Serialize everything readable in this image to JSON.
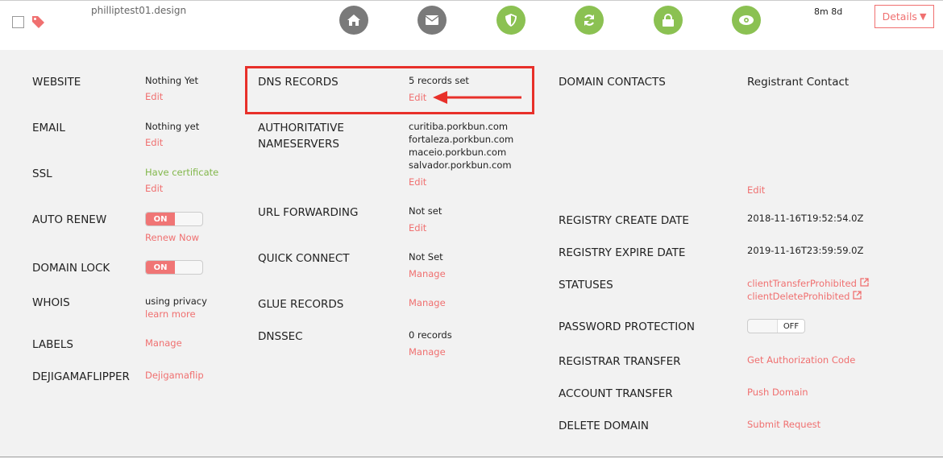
{
  "header": {
    "domain": "philliptest01.design",
    "time_left": "8m 8d",
    "details_label": "Details",
    "details_arrow": "▼",
    "icons": [
      "home-icon",
      "mail-icon",
      "shield-icon",
      "refresh-icon",
      "lock-icon",
      "eye-icon"
    ]
  },
  "col1": {
    "website": {
      "label": "WEBSITE",
      "value": "Nothing Yet",
      "link": "Edit"
    },
    "email": {
      "label": "EMAIL",
      "value": "Nothing yet",
      "link": "Edit"
    },
    "ssl": {
      "label": "SSL",
      "value": "Have certificate",
      "link": "Edit"
    },
    "auto_renew": {
      "label": "AUTO RENEW",
      "toggle": "ON",
      "link": "Renew Now"
    },
    "domain_lock": {
      "label": "DOMAIN LOCK",
      "toggle": "ON"
    },
    "whois": {
      "label": "WHOIS",
      "value": "using privacy",
      "link": "learn more"
    },
    "labels": {
      "label": "LABELS",
      "link": "Manage"
    },
    "dejigamaflipper": {
      "label": "DEJIGAMAFLIPPER",
      "link": "Dejigamaflip"
    }
  },
  "col2": {
    "dns": {
      "label": "DNS RECORDS",
      "value": "5 records set",
      "link": "Edit"
    },
    "ns": {
      "label1": "AUTHORITATIVE",
      "label2": "NAMESERVERS",
      "servers": [
        "curitiba.porkbun.com",
        "fortaleza.porkbun.com",
        "maceio.porkbun.com",
        "salvador.porkbun.com"
      ],
      "link": "Edit"
    },
    "url": {
      "label": "URL FORWARDING",
      "value": "Not set",
      "link": "Edit"
    },
    "quick": {
      "label": "QUICK CONNECT",
      "value": "Not Set",
      "link": "Manage"
    },
    "glue": {
      "label": "GLUE RECORDS",
      "link": "Manage"
    },
    "dnssec": {
      "label": "DNSSEC",
      "value": "0 records",
      "link": "Manage"
    }
  },
  "col3": {
    "contacts": {
      "label": "DOMAIN CONTACTS",
      "value": "Registrant Contact",
      "link": "Edit"
    },
    "create": {
      "label": "REGISTRY CREATE DATE",
      "value": "2018-11-16T19:52:54.0Z"
    },
    "expire": {
      "label": "REGISTRY EXPIRE DATE",
      "value": "2019-11-16T23:59:59.0Z"
    },
    "statuses": {
      "label": "STATUSES",
      "items": [
        "clientTransferProhibited",
        "clientDeleteProhibited"
      ]
    },
    "password": {
      "label": "PASSWORD PROTECTION",
      "toggle": "OFF"
    },
    "registrar": {
      "label": "REGISTRAR TRANSFER",
      "link": "Get Authorization Code"
    },
    "account": {
      "label": "ACCOUNT TRANSFER",
      "link": "Push Domain"
    },
    "delete": {
      "label": "DELETE DOMAIN",
      "link": "Submit Request"
    }
  },
  "colors": {
    "accent": "#f07070",
    "green": "#8bc152",
    "gray": "#7a7a7a",
    "highlight": "#e8302a"
  }
}
